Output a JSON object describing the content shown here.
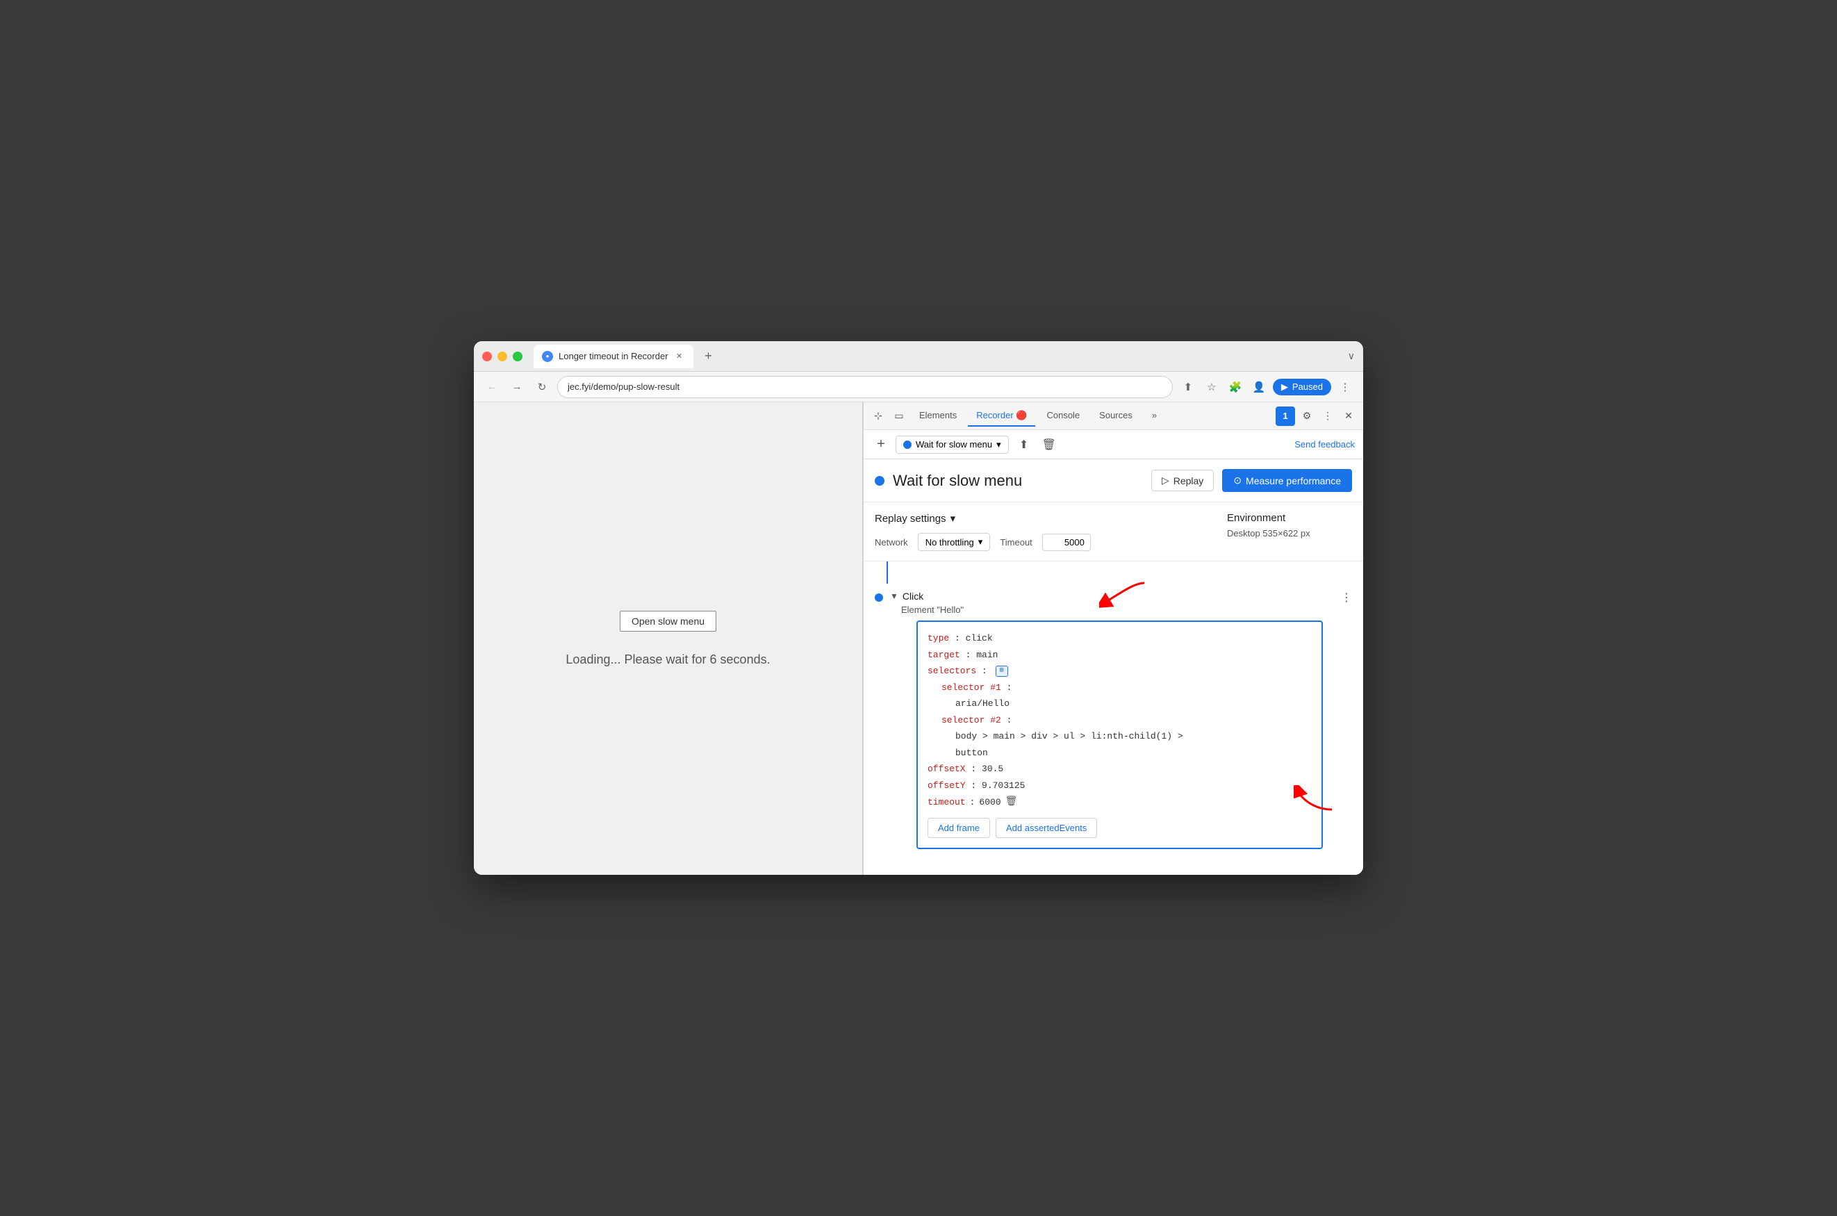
{
  "browser": {
    "tab_title": "Longer timeout in Recorder",
    "url": "jec.fyi/demo/pup-slow-result",
    "paused_label": "Paused",
    "chevron": "∨"
  },
  "nav": {
    "back": "←",
    "forward": "→",
    "refresh": "↻"
  },
  "page": {
    "button_label": "Open slow menu",
    "loading_text": "Loading... Please wait for 6 seconds."
  },
  "devtools": {
    "tabs": [
      {
        "label": "Elements",
        "active": false
      },
      {
        "label": "Recorder 🔴",
        "active": true
      },
      {
        "label": "Console",
        "active": false
      },
      {
        "label": "Sources",
        "active": false
      }
    ],
    "more_tabs": "»",
    "chat_badge": "1"
  },
  "recorder": {
    "add_btn": "+",
    "recording_name": "Wait for slow menu",
    "send_feedback": "Send feedback",
    "header": {
      "indicator_title": "Wait for slow menu",
      "replay_label": "Replay",
      "measure_label": "Measure performance"
    },
    "settings": {
      "title": "Replay settings",
      "network_label": "Network",
      "network_value": "No throttling",
      "timeout_label": "Timeout",
      "timeout_value": "5000"
    },
    "environment": {
      "title": "Environment",
      "value": "Desktop  535×622 px"
    },
    "step": {
      "type": "Click",
      "description": "Element \"Hello\"",
      "more": "⋮"
    },
    "code": {
      "type_key": "type",
      "type_val": "click",
      "target_key": "target",
      "target_val": "main",
      "selectors_key": "selectors",
      "selector1_key": "selector #1",
      "selector1_val": "aria/Hello",
      "selector2_key": "selector #2",
      "selector2_val1": "body > main > div > ul > li:nth-child(1) >",
      "selector2_val2": "button",
      "offsetX_key": "offsetX",
      "offsetX_val": "30.5",
      "offsetY_key": "offsetY",
      "offsetY_val": "9.703125",
      "timeout_key": "timeout",
      "timeout_val": "6000",
      "add_frame_btn": "Add frame",
      "add_asserted_btn": "Add assertedEvents"
    }
  }
}
